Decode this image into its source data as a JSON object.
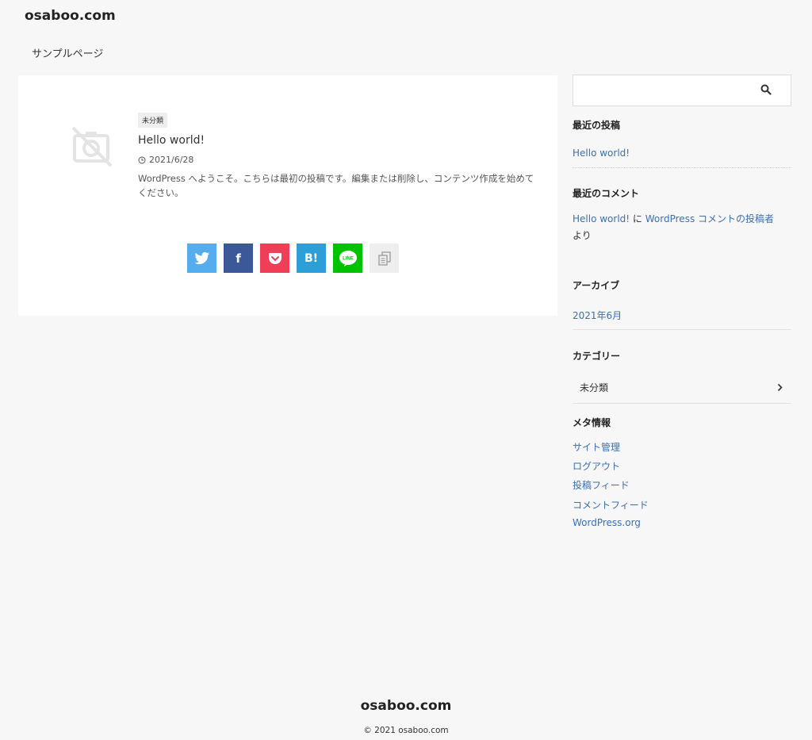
{
  "header": {
    "site_title": "osaboo.com"
  },
  "nav": {
    "items": [
      "サンプルページ"
    ]
  },
  "post": {
    "category": "未分類",
    "title": "Hello world!",
    "date": "2021/6/28",
    "excerpt": "WordPress へようこそ。こちらは最初の投稿です。編集または削除し、コンテンツ作成を始めてください。",
    "thumbnail_icon": "no-image-icon"
  },
  "share": {
    "buttons": [
      {
        "name": "twitter",
        "label": "",
        "color": "#55acee"
      },
      {
        "name": "facebook",
        "label": "f",
        "color": "#3b5998"
      },
      {
        "name": "pocket",
        "label": "",
        "color": "#ef3f56"
      },
      {
        "name": "hatena",
        "label": "B!",
        "color": "#2c9fd9"
      },
      {
        "name": "line",
        "label": "LINE",
        "color": "#00c300"
      },
      {
        "name": "copy",
        "label": "",
        "color": "#eeeeee"
      }
    ]
  },
  "sidebar": {
    "search": {
      "placeholder": "",
      "icon": "search-icon"
    },
    "recent_posts": {
      "title": "最近の投稿",
      "items": [
        "Hello world!"
      ]
    },
    "recent_comments": {
      "title": "最近のコメント",
      "post": "Hello world!",
      "connector": "に",
      "author": "WordPress コメントの投稿者",
      "suffix": "より"
    },
    "archives": {
      "title": "アーカイブ",
      "items": [
        "2021年6月"
      ]
    },
    "categories": {
      "title": "カテゴリー",
      "items": [
        "未分類"
      ]
    },
    "meta": {
      "title": "メタ情報",
      "items": [
        "サイト管理",
        "ログアウト",
        "投稿フィード",
        "コメントフィード",
        "WordPress.org"
      ]
    }
  },
  "footer": {
    "site_title": "osaboo.com",
    "copyright": "© 2021 osaboo.com"
  }
}
